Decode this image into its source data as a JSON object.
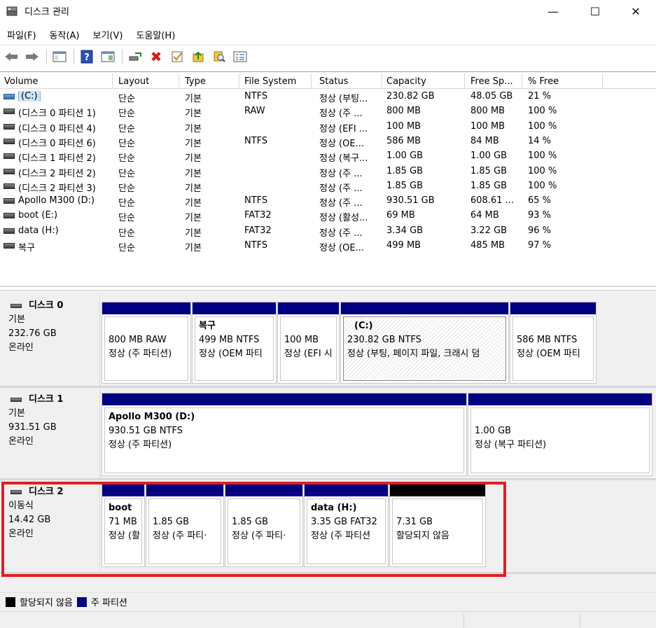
{
  "window": {
    "title": "디스크 관리",
    "minimize_glyph": "—",
    "maximize_glyph": "☐",
    "close_glyph": "✕"
  },
  "menu": [
    "파일(F)",
    "동작(A)",
    "보기(V)",
    "도움말(H)"
  ],
  "toolbar": {
    "icons": [
      "back-arrow-icon",
      "forward-arrow-icon",
      "console-tree-icon",
      "help-icon",
      "action-pane-icon",
      "connect-drive-icon",
      "delete-icon",
      "check-icon",
      "up-folder-icon",
      "search-icon",
      "properties-icon"
    ],
    "delete_glyph": "✖",
    "help_glyph": "?"
  },
  "volume_list": {
    "columns": [
      "Volume",
      "Layout",
      "Type",
      "File System",
      "Status",
      "Capacity",
      "Free Sp...",
      "% Free"
    ],
    "rows": [
      {
        "volume": "(C:)",
        "layout": "단순",
        "type": "기본",
        "fs": "NTFS",
        "status": "정상 (부팅...",
        "capacity": "230.82 GB",
        "free": "48.05 GB",
        "pct": "21 %"
      },
      {
        "volume": "(디스크 0 파티션 1)",
        "layout": "단순",
        "type": "기본",
        "fs": "RAW",
        "status": "정상 (주 ...",
        "capacity": "800 MB",
        "free": "800 MB",
        "pct": "100 %"
      },
      {
        "volume": "(디스크 0 파티션 4)",
        "layout": "단순",
        "type": "기본",
        "fs": "",
        "status": "정상 (EFI ...",
        "capacity": "100 MB",
        "free": "100 MB",
        "pct": "100 %"
      },
      {
        "volume": "(디스크 0 파티션 6)",
        "layout": "단순",
        "type": "기본",
        "fs": "NTFS",
        "status": "정상 (OE...",
        "capacity": "586 MB",
        "free": "84 MB",
        "pct": "14 %"
      },
      {
        "volume": "(디스크 1 파티션 2)",
        "layout": "단순",
        "type": "기본",
        "fs": "",
        "status": "정상 (복구...",
        "capacity": "1.00 GB",
        "free": "1.00 GB",
        "pct": "100 %"
      },
      {
        "volume": "(디스크 2 파티션 2)",
        "layout": "단순",
        "type": "기본",
        "fs": "",
        "status": "정상 (주 ...",
        "capacity": "1.85 GB",
        "free": "1.85 GB",
        "pct": "100 %"
      },
      {
        "volume": "(디스크 2 파티션 3)",
        "layout": "단순",
        "type": "기본",
        "fs": "",
        "status": "정상 (주 ...",
        "capacity": "1.85 GB",
        "free": "1.85 GB",
        "pct": "100 %"
      },
      {
        "volume": "Apollo M300 (D:)",
        "layout": "단순",
        "type": "기본",
        "fs": "NTFS",
        "status": "정상 (주 ...",
        "capacity": "930.51 GB",
        "free": "608.61 ...",
        "pct": "65 %"
      },
      {
        "volume": "boot (E:)",
        "layout": "단순",
        "type": "기본",
        "fs": "FAT32",
        "status": "정상 (활성...",
        "capacity": "69 MB",
        "free": "64 MB",
        "pct": "93 %"
      },
      {
        "volume": "data (H:)",
        "layout": "단순",
        "type": "기본",
        "fs": "FAT32",
        "status": "정상 (주 ...",
        "capacity": "3.34 GB",
        "free": "3.22 GB",
        "pct": "96 %"
      },
      {
        "volume": "복구",
        "layout": "단순",
        "type": "기본",
        "fs": "NTFS",
        "status": "정상 (OE...",
        "capacity": "499 MB",
        "free": "485 MB",
        "pct": "97 %"
      }
    ]
  },
  "disks": [
    {
      "name": "디스크 0",
      "kind": "기본",
      "size": "232.76 GB",
      "state": "온라인",
      "partitions": [
        {
          "name": "",
          "line1": "800 MB RAW",
          "line2": "정상 (주 파티션)"
        },
        {
          "name": "복구",
          "line1": "499 MB NTFS",
          "line2": "정상 (OEM 파티"
        },
        {
          "name": "",
          "line1": "100 MB",
          "line2": "정상 (EFI 시"
        },
        {
          "name": "(C:)",
          "line1": "230.82 GB NTFS",
          "line2": "정상 (부팅, 페이지 파일, 크래시 덤"
        },
        {
          "name": "",
          "line1": "586 MB NTFS",
          "line2": "정상 (OEM 파티"
        }
      ]
    },
    {
      "name": "디스크 1",
      "kind": "기본",
      "size": "931.51 GB",
      "state": "온라인",
      "partitions": [
        {
          "name": "Apollo M300  (D:)",
          "line1": "930.51 GB NTFS",
          "line2": "정상 (주 파티션)"
        },
        {
          "name": "",
          "line1": "1.00 GB",
          "line2": "정상 (복구 파티션)"
        }
      ]
    },
    {
      "name": "디스크 2",
      "kind": "이동식",
      "size": "14.42 GB",
      "state": "온라인",
      "partitions": [
        {
          "name": "boot",
          "line1": "71 MB",
          "line2": "정상 (활"
        },
        {
          "name": "",
          "line1": "1.85 GB",
          "line2": "정상 (주 파티·"
        },
        {
          "name": "",
          "line1": "1.85 GB",
          "line2": "정상 (주 파티·"
        },
        {
          "name": "data  (H:)",
          "line1": "3.35 GB FAT32",
          "line2": "정상 (주 파티션"
        },
        {
          "name": "",
          "line1": "7.31 GB",
          "line2": "할당되지 않음"
        }
      ]
    }
  ],
  "legend": [
    {
      "label": "할당되지 않음",
      "color": "#000000"
    },
    {
      "label": "주 파티션",
      "color": "#000080"
    }
  ],
  "colors": {
    "primary_partition": "#000080",
    "unallocated": "#000000",
    "highlight": "#e31e24"
  }
}
